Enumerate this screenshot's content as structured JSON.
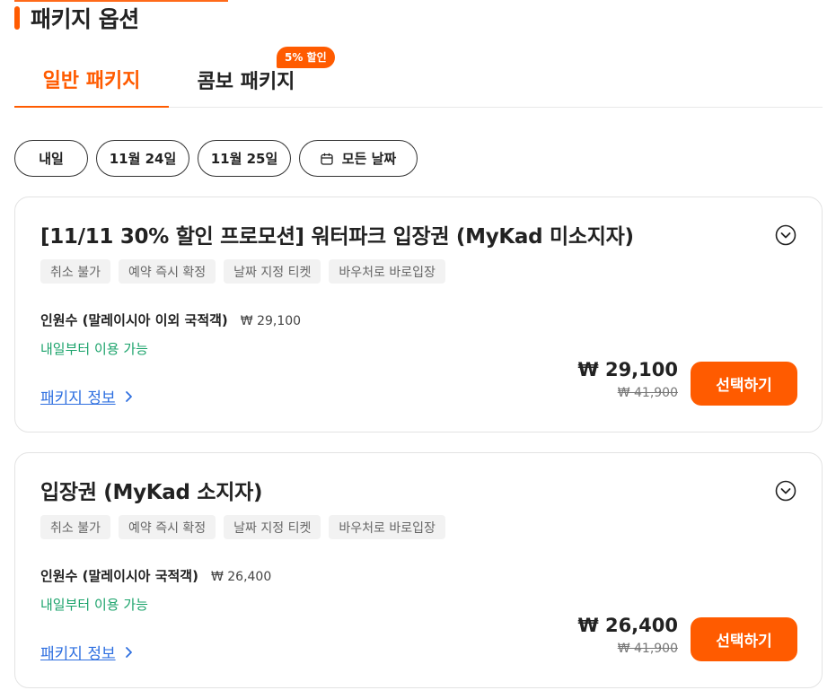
{
  "section": {
    "title": "패키지 옵션"
  },
  "tabs": [
    {
      "label": "일반 패키지",
      "active": true
    },
    {
      "label": "콤보 패키지",
      "active": false,
      "badge": "5% 할인"
    }
  ],
  "date_filters": [
    {
      "label": "내일"
    },
    {
      "label": "11월 24일"
    },
    {
      "label": "11월 25일"
    },
    {
      "label": "모든 날짜",
      "icon": "calendar-icon"
    }
  ],
  "packages": [
    {
      "title": "[11/11 30% 할인 프로모션] 워터파크 입장권 (MyKad 미소지자)",
      "tags": [
        "취소 불가",
        "예약 즉시 확정",
        "날짜 지정 티켓",
        "바우처로 바로입장"
      ],
      "pax_label": "인원수 (말레이시아 이외 국적객)",
      "pax_price": "₩ 29,100",
      "availability": "내일부터 이용 가능",
      "info_link": "패키지 정보",
      "price": "₩ 29,100",
      "original_price": "₩ 41,900",
      "select_label": "선택하기"
    },
    {
      "title": "입장권 (MyKad 소지자)",
      "tags": [
        "취소 불가",
        "예약 즉시 확정",
        "날짜 지정 티켓",
        "바우처로 바로입장"
      ],
      "pax_label": "인원수 (말레이시아 국적객)",
      "pax_price": "₩ 26,400",
      "availability": "내일부터 이용 가능",
      "info_link": "패키지 정보",
      "price": "₩ 26,400",
      "original_price": "₩ 41,900",
      "select_label": "선택하기"
    }
  ],
  "colors": {
    "accent": "#ff5b00",
    "available": "#1ba36b",
    "link": "#2e6fe0"
  }
}
